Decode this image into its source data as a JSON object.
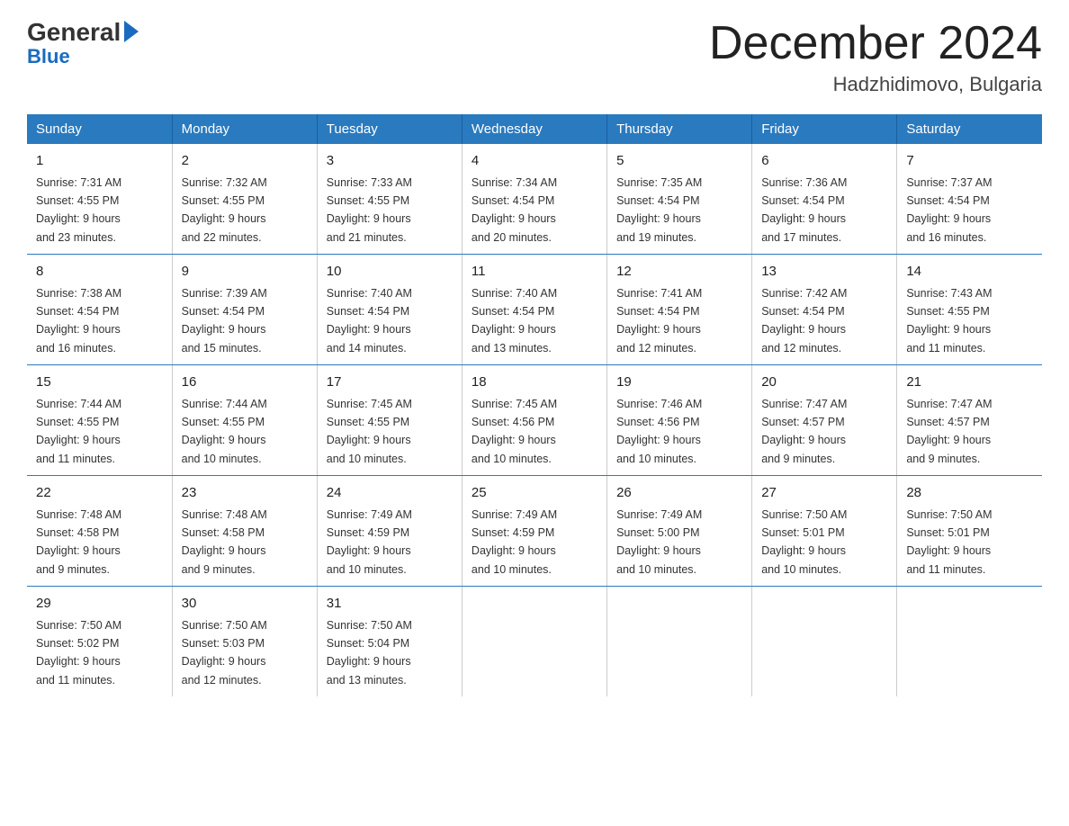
{
  "header": {
    "logo_general": "General",
    "logo_blue": "Blue",
    "month_title": "December 2024",
    "location": "Hadzhidimovo, Bulgaria"
  },
  "days_of_week": [
    "Sunday",
    "Monday",
    "Tuesday",
    "Wednesday",
    "Thursday",
    "Friday",
    "Saturday"
  ],
  "weeks": [
    [
      {
        "day": "1",
        "sunrise": "7:31 AM",
        "sunset": "4:55 PM",
        "daylight": "9 hours and 23 minutes."
      },
      {
        "day": "2",
        "sunrise": "7:32 AM",
        "sunset": "4:55 PM",
        "daylight": "9 hours and 22 minutes."
      },
      {
        "day": "3",
        "sunrise": "7:33 AM",
        "sunset": "4:55 PM",
        "daylight": "9 hours and 21 minutes."
      },
      {
        "day": "4",
        "sunrise": "7:34 AM",
        "sunset": "4:54 PM",
        "daylight": "9 hours and 20 minutes."
      },
      {
        "day": "5",
        "sunrise": "7:35 AM",
        "sunset": "4:54 PM",
        "daylight": "9 hours and 19 minutes."
      },
      {
        "day": "6",
        "sunrise": "7:36 AM",
        "sunset": "4:54 PM",
        "daylight": "9 hours and 17 minutes."
      },
      {
        "day": "7",
        "sunrise": "7:37 AM",
        "sunset": "4:54 PM",
        "daylight": "9 hours and 16 minutes."
      }
    ],
    [
      {
        "day": "8",
        "sunrise": "7:38 AM",
        "sunset": "4:54 PM",
        "daylight": "9 hours and 16 minutes."
      },
      {
        "day": "9",
        "sunrise": "7:39 AM",
        "sunset": "4:54 PM",
        "daylight": "9 hours and 15 minutes."
      },
      {
        "day": "10",
        "sunrise": "7:40 AM",
        "sunset": "4:54 PM",
        "daylight": "9 hours and 14 minutes."
      },
      {
        "day": "11",
        "sunrise": "7:40 AM",
        "sunset": "4:54 PM",
        "daylight": "9 hours and 13 minutes."
      },
      {
        "day": "12",
        "sunrise": "7:41 AM",
        "sunset": "4:54 PM",
        "daylight": "9 hours and 12 minutes."
      },
      {
        "day": "13",
        "sunrise": "7:42 AM",
        "sunset": "4:54 PM",
        "daylight": "9 hours and 12 minutes."
      },
      {
        "day": "14",
        "sunrise": "7:43 AM",
        "sunset": "4:55 PM",
        "daylight": "9 hours and 11 minutes."
      }
    ],
    [
      {
        "day": "15",
        "sunrise": "7:44 AM",
        "sunset": "4:55 PM",
        "daylight": "9 hours and 11 minutes."
      },
      {
        "day": "16",
        "sunrise": "7:44 AM",
        "sunset": "4:55 PM",
        "daylight": "9 hours and 10 minutes."
      },
      {
        "day": "17",
        "sunrise": "7:45 AM",
        "sunset": "4:55 PM",
        "daylight": "9 hours and 10 minutes."
      },
      {
        "day": "18",
        "sunrise": "7:45 AM",
        "sunset": "4:56 PM",
        "daylight": "9 hours and 10 minutes."
      },
      {
        "day": "19",
        "sunrise": "7:46 AM",
        "sunset": "4:56 PM",
        "daylight": "9 hours and 10 minutes."
      },
      {
        "day": "20",
        "sunrise": "7:47 AM",
        "sunset": "4:57 PM",
        "daylight": "9 hours and 9 minutes."
      },
      {
        "day": "21",
        "sunrise": "7:47 AM",
        "sunset": "4:57 PM",
        "daylight": "9 hours and 9 minutes."
      }
    ],
    [
      {
        "day": "22",
        "sunrise": "7:48 AM",
        "sunset": "4:58 PM",
        "daylight": "9 hours and 9 minutes."
      },
      {
        "day": "23",
        "sunrise": "7:48 AM",
        "sunset": "4:58 PM",
        "daylight": "9 hours and 9 minutes."
      },
      {
        "day": "24",
        "sunrise": "7:49 AM",
        "sunset": "4:59 PM",
        "daylight": "9 hours and 10 minutes."
      },
      {
        "day": "25",
        "sunrise": "7:49 AM",
        "sunset": "4:59 PM",
        "daylight": "9 hours and 10 minutes."
      },
      {
        "day": "26",
        "sunrise": "7:49 AM",
        "sunset": "5:00 PM",
        "daylight": "9 hours and 10 minutes."
      },
      {
        "day": "27",
        "sunrise": "7:50 AM",
        "sunset": "5:01 PM",
        "daylight": "9 hours and 10 minutes."
      },
      {
        "day": "28",
        "sunrise": "7:50 AM",
        "sunset": "5:01 PM",
        "daylight": "9 hours and 11 minutes."
      }
    ],
    [
      {
        "day": "29",
        "sunrise": "7:50 AM",
        "sunset": "5:02 PM",
        "daylight": "9 hours and 11 minutes."
      },
      {
        "day": "30",
        "sunrise": "7:50 AM",
        "sunset": "5:03 PM",
        "daylight": "9 hours and 12 minutes."
      },
      {
        "day": "31",
        "sunrise": "7:50 AM",
        "sunset": "5:04 PM",
        "daylight": "9 hours and 13 minutes."
      },
      null,
      null,
      null,
      null
    ]
  ],
  "labels": {
    "sunrise": "Sunrise:",
    "sunset": "Sunset:",
    "daylight": "Daylight:"
  }
}
